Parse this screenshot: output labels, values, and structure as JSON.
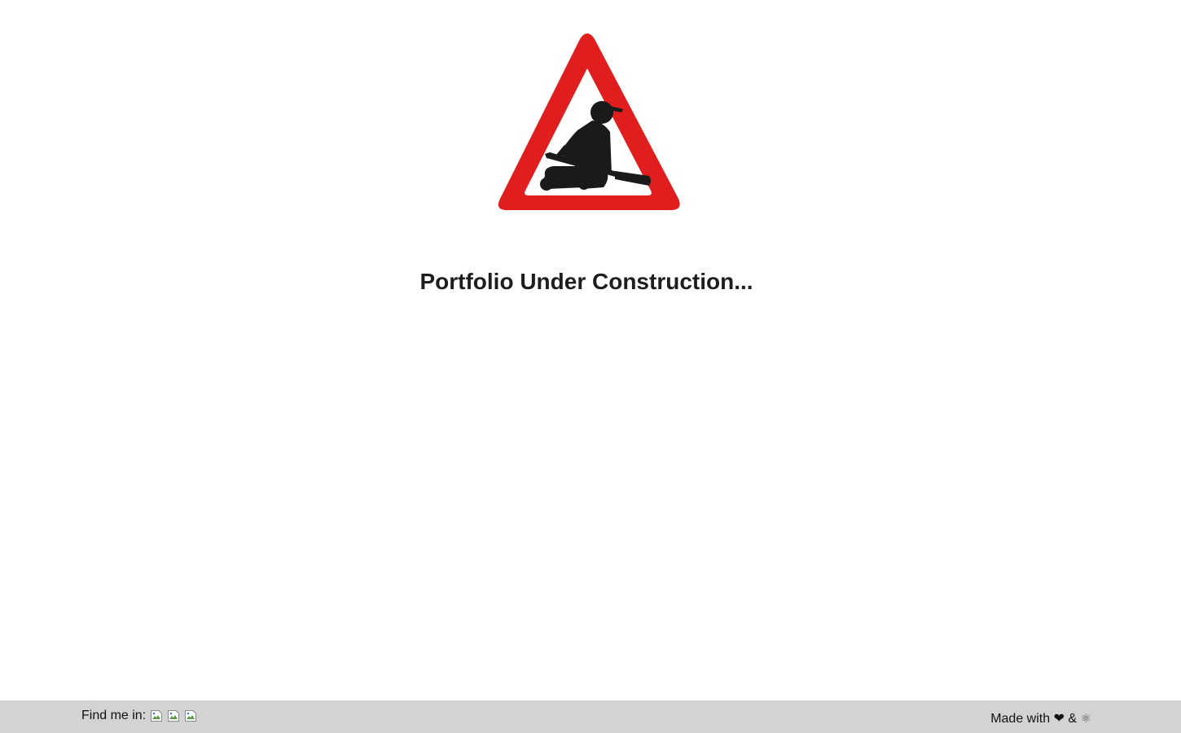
{
  "hero": {
    "sign_icon": "men-at-work-sign-icon",
    "headline": "Portfolio Under Construction..."
  },
  "footer": {
    "find_label": "Find me in:",
    "social_links": [
      {
        "name": "social-link-1",
        "icon": "broken-image-icon"
      },
      {
        "name": "social-link-2",
        "icon": "broken-image-icon"
      },
      {
        "name": "social-link-3",
        "icon": "broken-image-icon"
      }
    ],
    "made_with": {
      "prefix": "Made with",
      "heart": "❤",
      "ampersand": "&",
      "atom": "⚛"
    }
  },
  "colors": {
    "sign_red": "#e01e1e",
    "figure": "#1a1a1a",
    "footer_bg": "#d3d3d3",
    "headline": "#1e1e1e"
  }
}
